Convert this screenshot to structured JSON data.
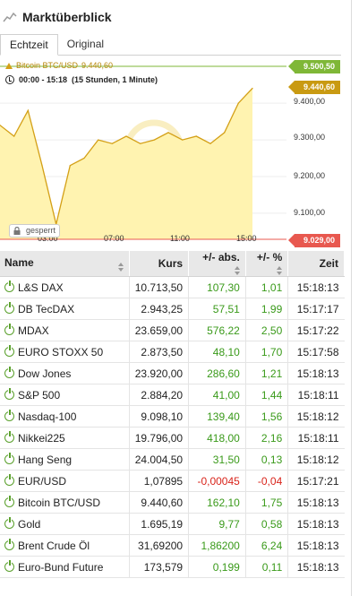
{
  "header": {
    "title": "Marktüberblick"
  },
  "tabs": [
    {
      "label": "Echtzeit",
      "active": true
    },
    {
      "label": "Original",
      "active": false
    }
  ],
  "chart": {
    "instrument_line": "Bitcoin BTC/USD",
    "instrument_price": "9.440,60",
    "time_range": "00:00 - 15:18",
    "duration": "(15 Stunden, 1 Minute)",
    "price_high": "9.500,50",
    "price_current": "9.440,60",
    "price_low": "9.029,00",
    "locked_label": "gesperrt",
    "y_ticks": [
      "9.400,00",
      "9.300,00",
      "9.200,00",
      "9.100,00"
    ],
    "x_ticks": [
      "03:00",
      "07:00",
      "11:00",
      "15:00"
    ],
    "colors": {
      "line": "#d4a017",
      "fill": "#fff3b0",
      "high": "#7fb737",
      "current": "#c99a12",
      "low": "#e8584f"
    }
  },
  "chart_data": {
    "type": "area",
    "title": "Bitcoin BTC/USD",
    "x": [
      "00:00",
      "01:00",
      "02:00",
      "02:30",
      "03:00",
      "04:00",
      "05:00",
      "06:00",
      "07:00",
      "08:00",
      "09:00",
      "10:00",
      "11:00",
      "12:00",
      "13:00",
      "14:00",
      "14:30",
      "15:00",
      "15:18"
    ],
    "values": [
      9340,
      9310,
      9380,
      9230,
      9070,
      9230,
      9250,
      9300,
      9290,
      9310,
      9290,
      9300,
      9320,
      9300,
      9310,
      9290,
      9320,
      9400,
      9440.6
    ],
    "ylim": [
      9029,
      9500.5
    ],
    "grid": true
  },
  "table": {
    "columns": [
      "Name",
      "Kurs",
      "+/- abs.",
      "+/- %",
      "Zeit"
    ],
    "rows": [
      {
        "name": "L&S DAX",
        "kurs": "10.713,50",
        "abs": "107,30",
        "pct": "1,01",
        "zeit": "15:18:13",
        "dir": "pos"
      },
      {
        "name": "DB TecDAX",
        "kurs": "2.943,25",
        "abs": "57,51",
        "pct": "1,99",
        "zeit": "15:17:17",
        "dir": "pos"
      },
      {
        "name": "MDAX",
        "kurs": "23.659,00",
        "abs": "576,22",
        "pct": "2,50",
        "zeit": "15:17:22",
        "dir": "pos"
      },
      {
        "name": "EURO STOXX 50",
        "kurs": "2.873,50",
        "abs": "48,10",
        "pct": "1,70",
        "zeit": "15:17:58",
        "dir": "pos"
      },
      {
        "name": "Dow Jones",
        "kurs": "23.920,00",
        "abs": "286,60",
        "pct": "1,21",
        "zeit": "15:18:13",
        "dir": "pos"
      },
      {
        "name": "S&P 500",
        "kurs": "2.884,20",
        "abs": "41,00",
        "pct": "1,44",
        "zeit": "15:18:11",
        "dir": "pos"
      },
      {
        "name": "Nasdaq-100",
        "kurs": "9.098,10",
        "abs": "139,40",
        "pct": "1,56",
        "zeit": "15:18:12",
        "dir": "pos"
      },
      {
        "name": "Nikkei225",
        "kurs": "19.796,00",
        "abs": "418,00",
        "pct": "2,16",
        "zeit": "15:18:11",
        "dir": "pos"
      },
      {
        "name": "Hang Seng",
        "kurs": "24.004,50",
        "abs": "31,50",
        "pct": "0,13",
        "zeit": "15:18:12",
        "dir": "pos"
      },
      {
        "name": "EUR/USD",
        "kurs": "1,07895",
        "abs": "-0,00045",
        "pct": "-0,04",
        "zeit": "15:17:21",
        "dir": "neg"
      },
      {
        "name": "Bitcoin BTC/USD",
        "kurs": "9.440,60",
        "abs": "162,10",
        "pct": "1,75",
        "zeit": "15:18:13",
        "dir": "pos"
      },
      {
        "name": "Gold",
        "kurs": "1.695,19",
        "abs": "9,77",
        "pct": "0,58",
        "zeit": "15:18:13",
        "dir": "pos"
      },
      {
        "name": "Brent Crude Öl",
        "kurs": "31,69200",
        "abs": "1,86200",
        "pct": "6,24",
        "zeit": "15:18:13",
        "dir": "pos"
      },
      {
        "name": "Euro-Bund Future",
        "kurs": "173,579",
        "abs": "0,199",
        "pct": "0,11",
        "zeit": "15:18:13",
        "dir": "pos"
      }
    ]
  }
}
